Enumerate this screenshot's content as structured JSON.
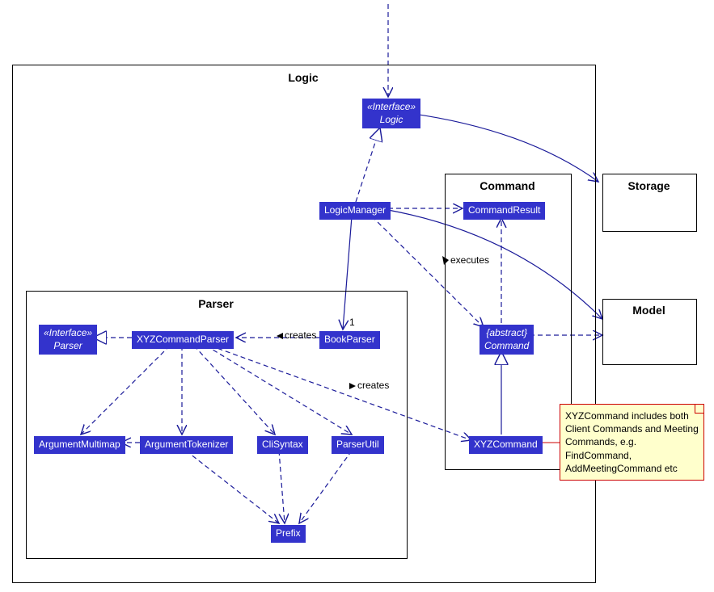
{
  "packages": {
    "logic": {
      "title": "Logic"
    },
    "parser": {
      "title": "Parser"
    },
    "command": {
      "title": "Command"
    },
    "storage": {
      "title": "Storage"
    },
    "model": {
      "title": "Model"
    }
  },
  "classes": {
    "iface_logic": {
      "stereotype": "«Interface»",
      "name": "Logic"
    },
    "logic_manager": {
      "name": "LogicManager"
    },
    "command_result": {
      "name": "CommandResult"
    },
    "abstract_command": {
      "stereotype": "{abstract}",
      "name": "Command"
    },
    "xyz_command": {
      "name": "XYZCommand"
    },
    "book_parser": {
      "name": "BookParser"
    },
    "xyz_parser": {
      "name": "XYZCommandParser"
    },
    "iface_parser": {
      "stereotype": "«Interface»",
      "name": "Parser"
    },
    "arg_multimap": {
      "name": "ArgumentMultimap"
    },
    "arg_tokenizer": {
      "name": "ArgumentTokenizer"
    },
    "cli_syntax": {
      "name": "CliSyntax"
    },
    "parser_util": {
      "name": "ParserUtil"
    },
    "prefix": {
      "name": "Prefix"
    }
  },
  "labels": {
    "creates1": "creates",
    "creates2": "creates",
    "executes": "executes",
    "one": "1"
  },
  "note": {
    "text": "XYZCommand includes both Client Commands and Meeting Commands, e.g. FindCommand, AddMeetingCommand etc"
  }
}
